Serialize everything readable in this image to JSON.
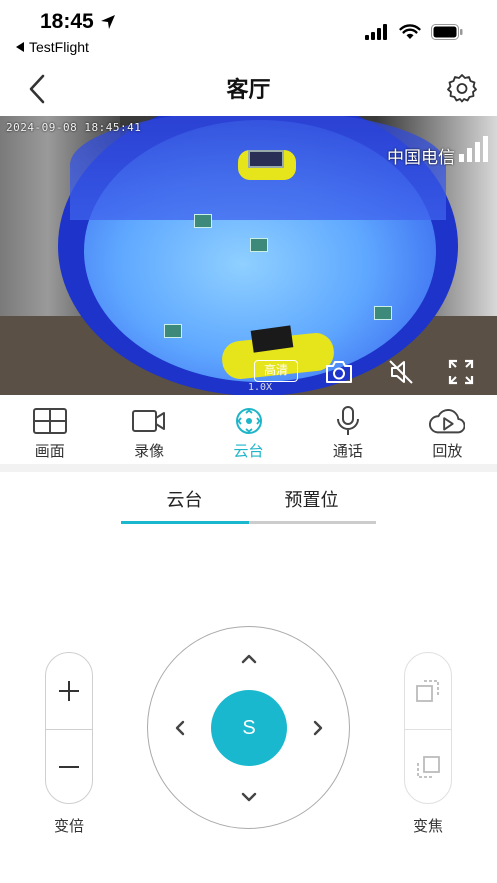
{
  "status_bar": {
    "time": "18:45",
    "back_app": "TestFlight"
  },
  "nav": {
    "title": "客厅",
    "back_icon": "chevron-left-icon",
    "settings_icon": "gear-icon"
  },
  "video": {
    "timestamp": "2024-09-08 18:45:41",
    "carrier": "中国电信",
    "quality_label": "高清",
    "zoom_label": "1.0X"
  },
  "functions": [
    {
      "label": "画面",
      "icon": "grid-icon",
      "active": false
    },
    {
      "label": "录像",
      "icon": "video-camera-icon",
      "active": false
    },
    {
      "label": "云台",
      "icon": "ptz-icon",
      "active": true
    },
    {
      "label": "通话",
      "icon": "microphone-icon",
      "active": false
    },
    {
      "label": "回放",
      "icon": "cloud-play-icon",
      "active": false
    }
  ],
  "tabs": [
    {
      "label": "云台",
      "active": true
    },
    {
      "label": "预置位",
      "active": false
    }
  ],
  "controls": {
    "zoom_label": "变倍",
    "focus_label": "变焦",
    "center_label": "S"
  },
  "colors": {
    "accent": "#1ab8cf",
    "tab_inactive_line": "#cccccc",
    "pool_blue": "#3c6cf0"
  }
}
